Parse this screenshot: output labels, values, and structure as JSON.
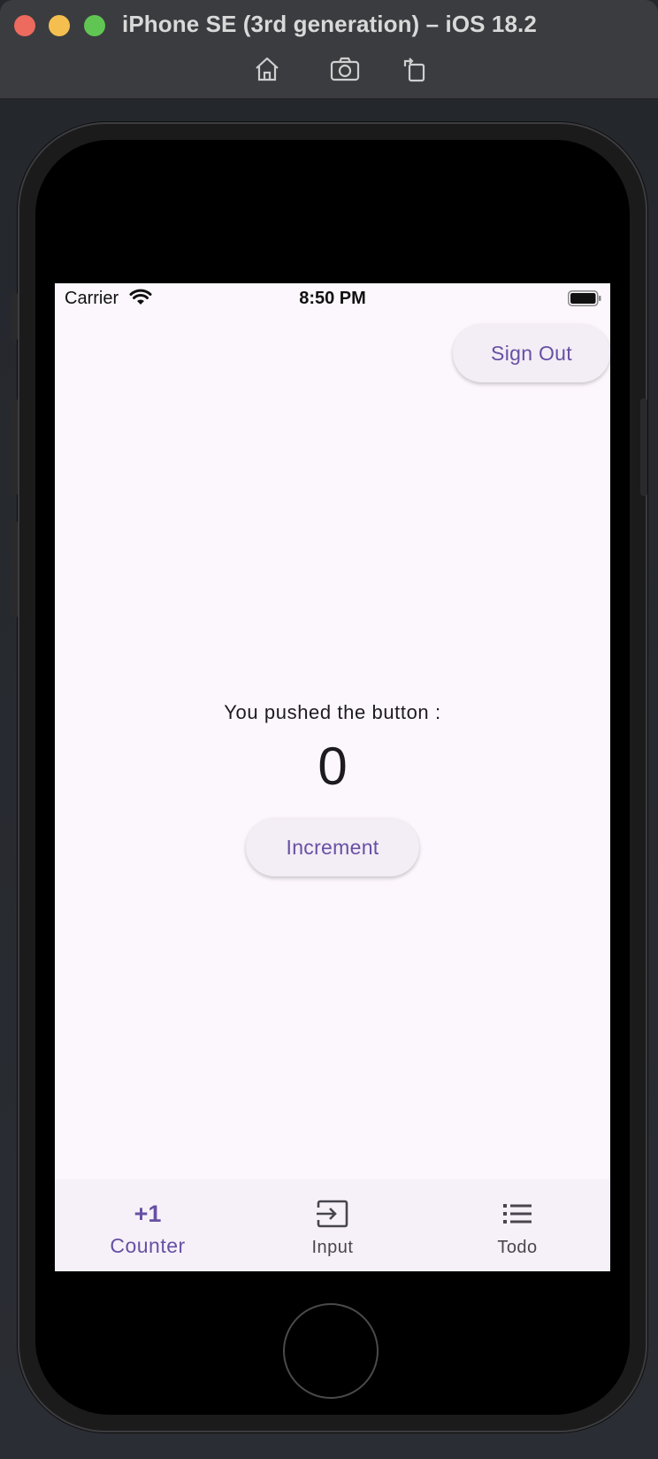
{
  "window": {
    "title": "iPhone SE (3rd generation) – iOS 18.2",
    "toolbar": {
      "home_icon": "home-icon",
      "screenshot_icon": "camera-icon",
      "rotate_icon": "rotate-icon"
    }
  },
  "status_bar": {
    "carrier": "Carrier",
    "time": "8:50 PM"
  },
  "app": {
    "sign_out_label": "Sign Out",
    "counter_caption": "You pushed the button :",
    "counter_value": "0",
    "increment_label": "Increment"
  },
  "bottom_nav": {
    "items": [
      {
        "label": "Counter",
        "icon": "plus-one-icon",
        "icon_text": "+1",
        "active": true
      },
      {
        "label": "Input",
        "icon": "input-icon",
        "active": false
      },
      {
        "label": "Todo",
        "icon": "list-icon",
        "active": false
      }
    ]
  },
  "colors": {
    "accent": "#6750a4",
    "surface": "#fcf7fc",
    "button_surface": "#f3edf5",
    "nav_surface": "#f6f1f8",
    "text": "#1d1b20",
    "muted_text": "#49454f"
  }
}
